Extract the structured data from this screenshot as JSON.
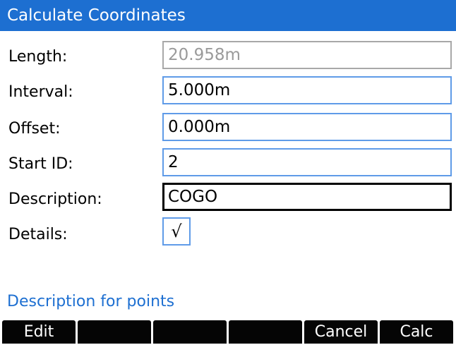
{
  "title": "Calculate Coordinates",
  "fields": {
    "length": {
      "label": "Length:",
      "value": "20.958m"
    },
    "interval": {
      "label": "Interval:",
      "value": "5.000m"
    },
    "offset": {
      "label": "Offset:",
      "value": "0.000m"
    },
    "start_id": {
      "label": "Start ID:",
      "value": "2"
    },
    "description": {
      "label": "Description:",
      "value": "COGO"
    },
    "details": {
      "label": "Details:",
      "checked_glyph": "√"
    }
  },
  "status_text": "Description for points",
  "softkeys": [
    "Edit",
    "",
    "",
    "",
    "Cancel",
    "Calc"
  ]
}
